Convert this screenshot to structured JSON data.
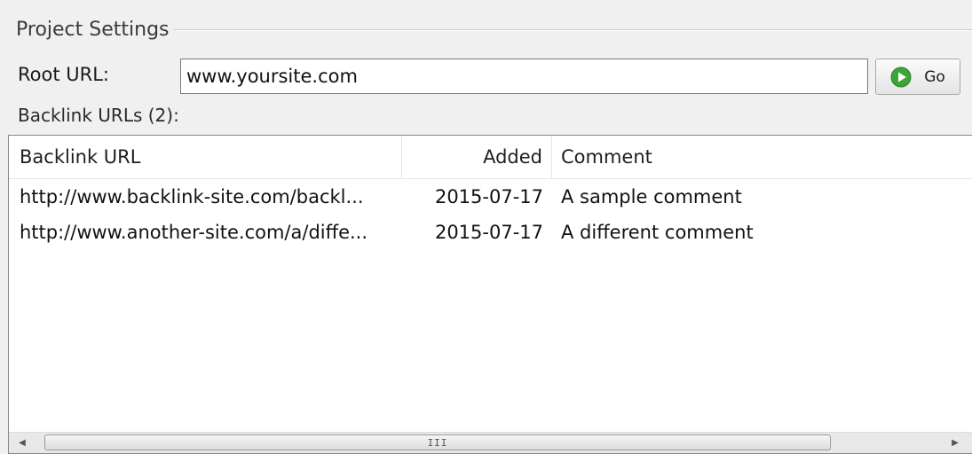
{
  "group": {
    "title": "Project Settings"
  },
  "root_url": {
    "label": "Root URL:",
    "value": "www.yoursite.com"
  },
  "go_button": {
    "label": "Go",
    "icon": "play-circle-icon",
    "icon_color": "#3aa63a"
  },
  "backlinks": {
    "label": "Backlink URLs (2):",
    "columns": {
      "url": "Backlink URL",
      "added": "Added",
      "comment": "Comment"
    },
    "rows": [
      {
        "url": "http://www.backlink-site.com/backl...",
        "added": "2015-07-17",
        "comment": "A sample comment"
      },
      {
        "url": "http://www.another-site.com/a/diffe...",
        "added": "2015-07-17",
        "comment": "A different comment"
      }
    ]
  },
  "scrollbar": {
    "left_arrow": "◀",
    "right_arrow": "▶",
    "grip": "III"
  }
}
